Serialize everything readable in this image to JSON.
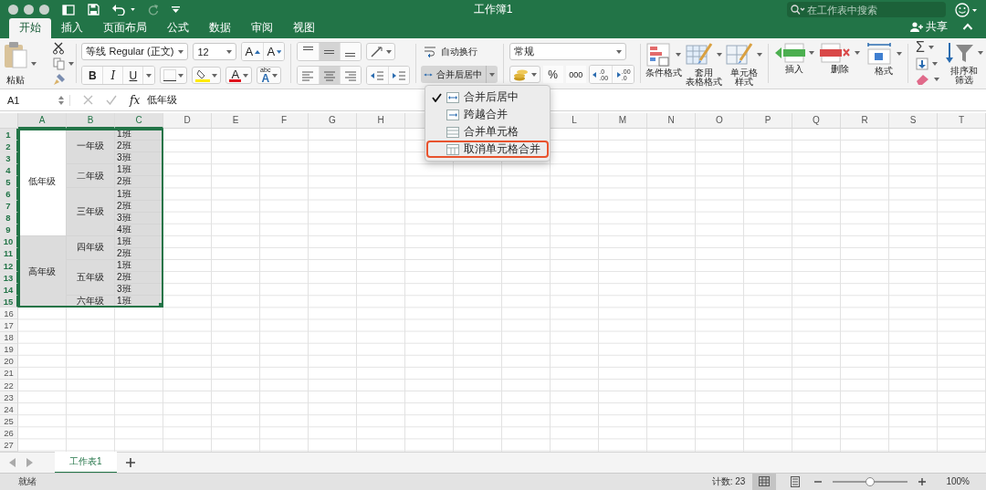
{
  "title_bar": {
    "title": "工作簿1",
    "search": {
      "placeholder": "在工作表中搜索"
    }
  },
  "ribbon_tabs": [
    {
      "label": "开始",
      "selected": true
    },
    {
      "label": "插入",
      "selected": false
    },
    {
      "label": "页面布局",
      "selected": false
    },
    {
      "label": "公式",
      "selected": false
    },
    {
      "label": "数据",
      "selected": false
    },
    {
      "label": "审阅",
      "selected": false
    },
    {
      "label": "视图",
      "selected": false
    }
  ],
  "share": {
    "label": "共享"
  },
  "ribbon": {
    "paste_label": "粘贴",
    "font": {
      "name": "等线 Regular (正文)",
      "size": "12"
    },
    "size_buttons": [
      {
        "kind": "grow",
        "label": "A"
      },
      {
        "kind": "shrink",
        "label": "A"
      }
    ],
    "format_toggles": [
      {
        "kind": "bold",
        "label": "B",
        "selected": false
      },
      {
        "kind": "italic",
        "label": "I",
        "selected": false
      },
      {
        "kind": "underline",
        "label": "U",
        "selected": false
      }
    ],
    "font_color_label": "A",
    "phonetic": {
      "small": "abc",
      "big": "A"
    },
    "vertical_align": [
      {
        "kind": "top",
        "selected": false
      },
      {
        "kind": "middle",
        "selected": true
      },
      {
        "kind": "bottom",
        "selected": false
      }
    ],
    "horizontal_align": [
      {
        "kind": "left",
        "selected": false
      },
      {
        "kind": "center",
        "selected": true
      },
      {
        "kind": "right",
        "selected": false
      }
    ],
    "wrap_text": {
      "label": "自动换行"
    },
    "merge": {
      "label": "合并后居中",
      "expanded": true
    },
    "number_format": "常规",
    "percent_label": "%",
    "thousands_label": "000",
    "decimal_buttons": [
      {
        "kind": "increase",
        "top": ".0",
        "bottom": ".00"
      },
      {
        "kind": "decrease",
        "top": ".00",
        "bottom": ".0"
      }
    ],
    "style_buttons": [
      {
        "kind": "conditional",
        "lines": [
          "条件格式"
        ]
      },
      {
        "kind": "table",
        "lines": [
          "套用",
          "表格格式"
        ]
      },
      {
        "kind": "cell",
        "lines": [
          "单元格",
          "样式"
        ]
      }
    ],
    "cell_buttons": [
      {
        "kind": "insert",
        "label": "插入"
      },
      {
        "kind": "delete",
        "label": "删除"
      },
      {
        "kind": "format",
        "label": "格式"
      }
    ],
    "sum_label": "Σ",
    "sort_filter": {
      "lines": [
        "排序和",
        "筛选"
      ]
    }
  },
  "merge_menu": [
    {
      "kind": "center",
      "label": "合并后居中",
      "checked": true,
      "highlighted": false
    },
    {
      "kind": "across",
      "label": "跨越合并",
      "checked": false,
      "highlighted": false
    },
    {
      "kind": "merge",
      "label": "合并单元格",
      "checked": false,
      "highlighted": false
    },
    {
      "kind": "unmerge",
      "label": "取消单元格合并",
      "checked": false,
      "highlighted": true
    }
  ],
  "formula_bar": {
    "cell_ref": "A1",
    "function_label": "fx",
    "content": "低年级"
  },
  "sheet": {
    "columns": [
      {
        "label": "A",
        "selected": true
      },
      {
        "label": "B",
        "selected": true
      },
      {
        "label": "C",
        "selected": true
      },
      {
        "label": "D",
        "selected": false
      },
      {
        "label": "E",
        "selected": false
      },
      {
        "label": "F",
        "selected": false
      },
      {
        "label": "G",
        "selected": false
      },
      {
        "label": "H",
        "selected": false
      },
      {
        "selected": false
      },
      null,
      null,
      {
        "label": "L",
        "selected": false
      },
      {
        "label": "M",
        "selected": false
      },
      {
        "label": "N",
        "selected": false
      },
      {
        "label": "O",
        "selected": false
      },
      {
        "label": "P",
        "selected": false
      },
      {
        "label": "Q",
        "selected": false
      },
      {
        "label": "R",
        "selected": false
      },
      {
        "label": "S",
        "selected": false
      },
      {
        "label": "T",
        "selected": false
      }
    ],
    "rows": [
      {
        "label": "1",
        "selected": true
      },
      {
        "label": "2",
        "selected": true
      },
      {
        "label": "3",
        "selected": true
      },
      {
        "label": "4",
        "selected": true
      },
      {
        "label": "5",
        "selected": true
      },
      {
        "label": "6",
        "selected": true
      },
      {
        "label": "7",
        "selected": true
      },
      {
        "label": "8",
        "selected": true
      },
      {
        "label": "9",
        "selected": true
      },
      {
        "label": "10",
        "selected": true
      },
      {
        "label": "11",
        "selected": true
      },
      {
        "label": "12",
        "selected": true
      },
      {
        "label": "13",
        "selected": true
      },
      {
        "label": "14",
        "selected": true
      },
      {
        "label": "15",
        "selected": true
      },
      {
        "label": "16",
        "selected": false
      },
      {
        "label": "17",
        "selected": false
      },
      {
        "label": "18",
        "selected": false
      },
      {
        "label": "19",
        "selected": false
      },
      {
        "label": "20",
        "selected": false
      },
      {
        "label": "21",
        "selected": false
      },
      {
        "label": "22",
        "selected": false
      },
      {
        "label": "23",
        "selected": false
      },
      {
        "label": "24",
        "selected": false
      },
      {
        "label": "25",
        "selected": false
      },
      {
        "label": "26",
        "selected": false
      },
      {
        "label": "27",
        "selected": false
      }
    ],
    "cells": [
      [
        {
          "text": "低年级",
          "rowspan": 9,
          "kind": "centered",
          "highlighted": false
        },
        {
          "text": "高年级",
          "rowspan": 6,
          "kind": "centered",
          "highlighted": true
        }
      ],
      [
        {
          "text": "一年级",
          "rowspan": 3,
          "kind": "centered",
          "highlighted": true
        },
        {
          "text": "二年级",
          "rowspan": 2,
          "kind": "centered",
          "highlighted": true
        },
        {
          "text": "三年级",
          "rowspan": 4,
          "kind": "centered",
          "highlighted": true
        },
        {
          "text": "四年级",
          "rowspan": 2,
          "kind": "centered",
          "highlighted": true
        },
        {
          "text": "五年级",
          "rowspan": 3,
          "kind": "centered",
          "highlighted": true
        },
        {
          "text": "六年级",
          "kind": "centered",
          "highlighted": true
        }
      ],
      [
        {
          "text": "1班",
          "kind": "plain",
          "highlighted": true
        },
        {
          "text": "2班",
          "kind": "plain",
          "highlighted": true
        },
        {
          "text": "3班",
          "kind": "plain",
          "highlighted": true
        },
        {
          "text": "1班",
          "kind": "plain",
          "highlighted": true
        },
        {
          "text": "2班",
          "kind": "plain",
          "highlighted": true
        },
        {
          "text": "1班",
          "kind": "plain",
          "highlighted": true
        },
        {
          "text": "2班",
          "kind": "plain",
          "highlighted": true
        },
        {
          "text": "3班",
          "kind": "plain",
          "highlighted": true
        },
        {
          "text": "4班",
          "kind": "plain",
          "highlighted": true
        },
        {
          "text": "1班",
          "kind": "plain",
          "highlighted": true
        },
        {
          "text": "2班",
          "kind": "plain",
          "highlighted": true
        },
        {
          "text": "1班",
          "kind": "plain",
          "highlighted": true
        },
        {
          "text": "2班",
          "kind": "plain",
          "highlighted": true
        },
        {
          "text": "3班",
          "kind": "plain",
          "highlighted": true
        },
        {
          "text": "1班",
          "kind": "plain",
          "highlighted": true
        }
      ]
    ]
  },
  "sheet_tabs": [
    {
      "label": "工作表1",
      "selected": true
    }
  ],
  "status_bar": {
    "status": "就绪",
    "count": "计数: 23",
    "views": [
      {
        "kind": "normal",
        "selected": true
      },
      {
        "kind": "page",
        "selected": false
      }
    ],
    "zoom": {
      "level": 0.5,
      "reading": "100%"
    }
  }
}
